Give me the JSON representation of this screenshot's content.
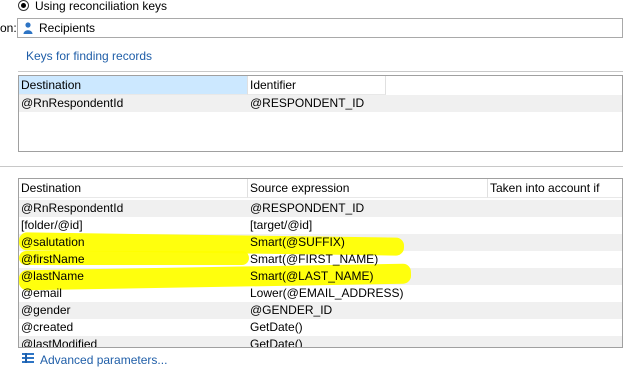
{
  "reconciliation": {
    "radio_label": "Using reconciliation keys",
    "target_label_fragment": "on:",
    "target_value": "Recipients"
  },
  "keys_section": {
    "title": "Keys for finding records",
    "columns": [
      "Destination",
      "Identifier"
    ],
    "rows": [
      [
        "@RnRespondentId",
        "@RESPONDENT_ID"
      ]
    ]
  },
  "mapping_grid": {
    "columns": [
      "Destination",
      "Source expression",
      "Taken into account if"
    ],
    "rows": [
      [
        "@RnRespondentId",
        "@RESPONDENT_ID",
        ""
      ],
      [
        "[folder/@id]",
        "[target/@id]",
        ""
      ],
      [
        "@salutation",
        "Smart(@SUFFIX)",
        ""
      ],
      [
        "@firstName",
        "Smart(@FIRST_NAME)",
        ""
      ],
      [
        "@lastName",
        "Smart(@LAST_NAME)",
        ""
      ],
      [
        "@email",
        "Lower(@EMAIL_ADDRESS)",
        ""
      ],
      [
        "@gender",
        "@GENDER_ID",
        ""
      ],
      [
        "@created",
        "GetDate()",
        ""
      ],
      [
        "@lastModified",
        "GetDate()",
        ""
      ]
    ]
  },
  "footer": {
    "advanced_link": "Advanced parameters..."
  },
  "colors": {
    "link": "#1f5ea8",
    "highlight": "#ffff00",
    "selected_header": "#cce8ff"
  }
}
